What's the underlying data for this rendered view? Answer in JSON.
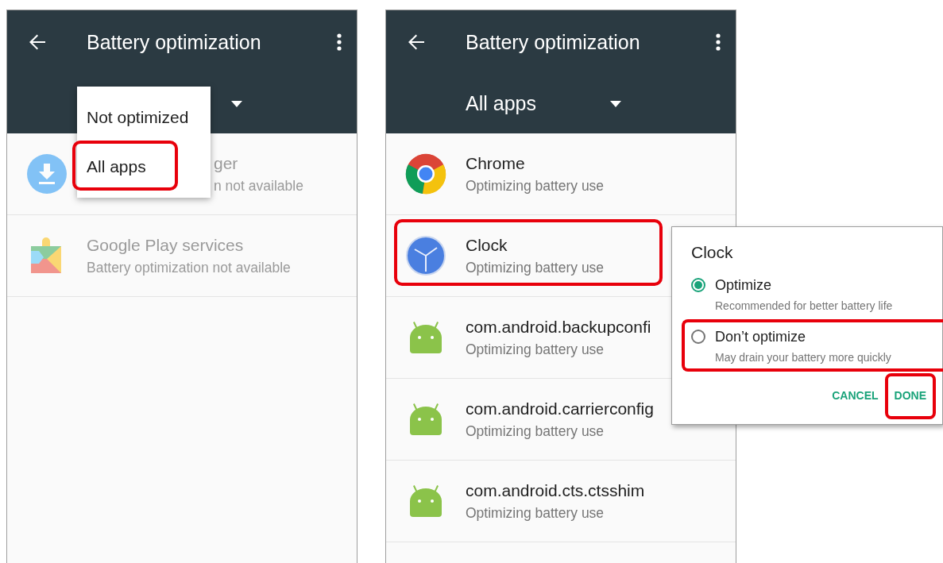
{
  "screens": [
    {
      "toolbar": {
        "title": "Battery optimization"
      },
      "menu": {
        "items": [
          {
            "label": "Not optimized",
            "highlighted": false
          },
          {
            "label": "All apps",
            "highlighted": true
          }
        ]
      },
      "apps": [
        {
          "kind": "download",
          "name": "ger",
          "status": "n not available",
          "disabled": true,
          "partly_hidden": true,
          "highlighted": false
        },
        {
          "kind": "puzzle",
          "name": "Google Play services",
          "status": "Battery optimization not available",
          "disabled": true,
          "partly_hidden": false,
          "highlighted": false
        }
      ]
    },
    {
      "toolbar": {
        "title": "Battery optimization"
      },
      "spinner": {
        "label": "All apps"
      },
      "apps": [
        {
          "kind": "chrome",
          "name": "Chrome",
          "status": "Optimizing battery use",
          "disabled": false,
          "partly_hidden": false,
          "highlighted": false
        },
        {
          "kind": "clock",
          "name": "Clock",
          "status": "Optimizing battery use",
          "disabled": false,
          "partly_hidden": false,
          "highlighted": true
        },
        {
          "kind": "android",
          "name": "com.android.backupconfi",
          "status": "Optimizing battery use",
          "disabled": false,
          "partly_hidden": false,
          "highlighted": false
        },
        {
          "kind": "android",
          "name": "com.android.carrierconfig",
          "status": "Optimizing battery use",
          "disabled": false,
          "partly_hidden": false,
          "highlighted": false
        },
        {
          "kind": "android",
          "name": "com.android.cts.ctsshim",
          "status": "Optimizing battery use",
          "disabled": false,
          "partly_hidden": false,
          "highlighted": false
        }
      ]
    }
  ],
  "dialog": {
    "title": "Clock",
    "options": [
      {
        "label": "Optimize",
        "hint": "Recommended for better battery life",
        "selected": true,
        "highlighted": false
      },
      {
        "label": "Don’t optimize",
        "hint": "May drain your battery more quickly",
        "selected": false,
        "highlighted": true
      }
    ],
    "buttons": [
      {
        "label": "CANCEL",
        "highlighted": false
      },
      {
        "label": "DONE",
        "highlighted": true
      }
    ]
  }
}
